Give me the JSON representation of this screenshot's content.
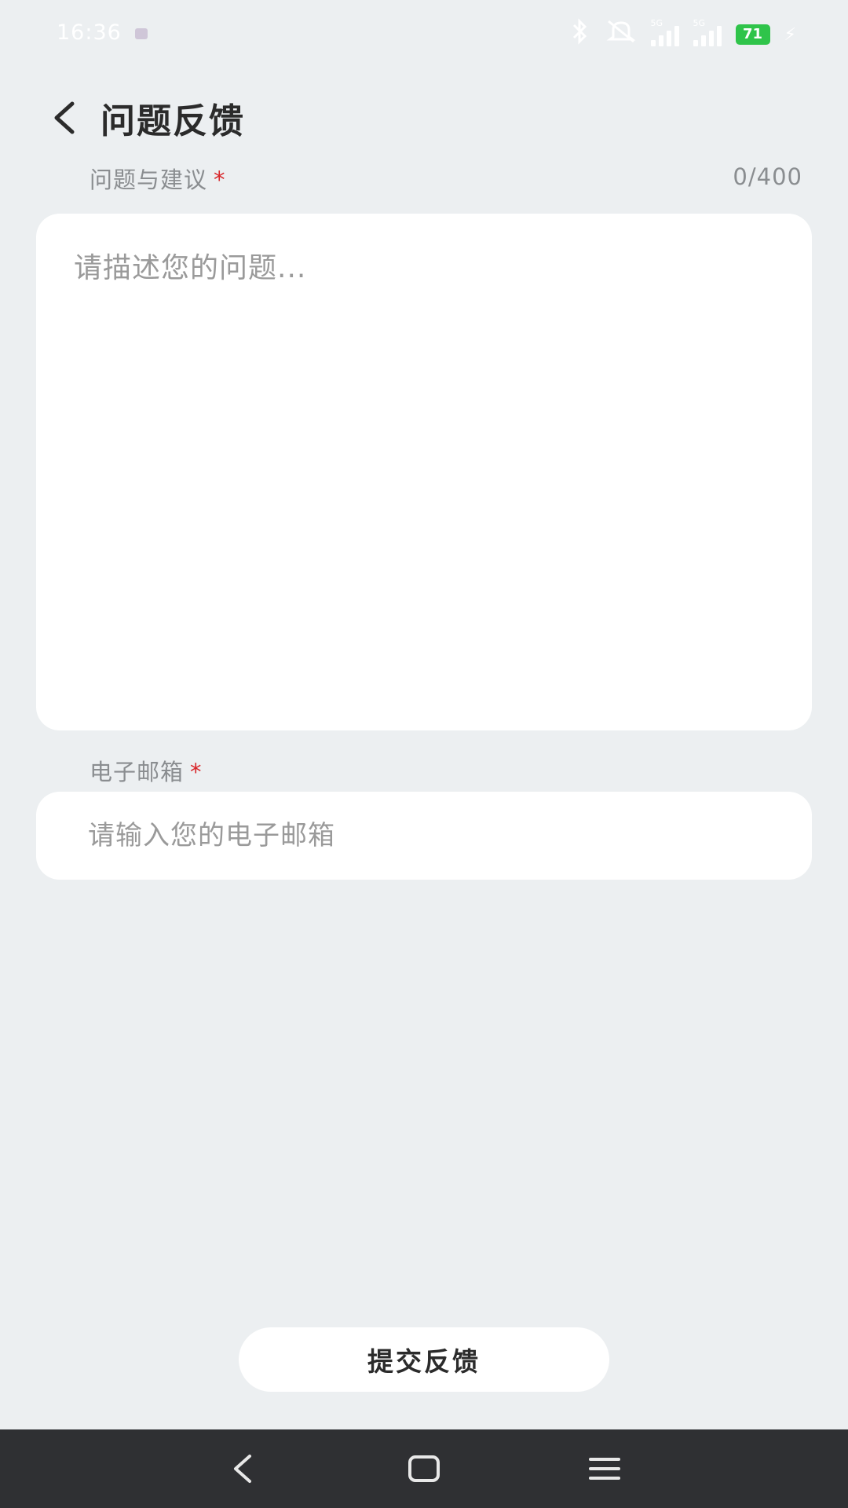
{
  "status_bar": {
    "time": "16:36",
    "network_1": "5G",
    "network_2": "5G",
    "battery": "71"
  },
  "header": {
    "title": "问题反馈"
  },
  "form": {
    "problem_label": "问题与建议",
    "problem_required": "*",
    "problem_counter": "0/400",
    "problem_placeholder": "请描述您的问题...",
    "email_label": "电子邮箱",
    "email_required": "*",
    "email_placeholder": "请输入您的电子邮箱"
  },
  "submit": {
    "label": "提交反馈"
  },
  "icons": {
    "back": "chevron-left-icon",
    "bluetooth": "bluetooth-icon",
    "mute": "mute-icon",
    "nav_back": "nav-back-icon",
    "nav_home": "nav-home-icon",
    "nav_menu": "nav-menu-icon"
  },
  "colors": {
    "background": "#eceff1",
    "required": "#d8262a",
    "battery": "#2fc44a",
    "nav_bar": "#2f3033"
  }
}
